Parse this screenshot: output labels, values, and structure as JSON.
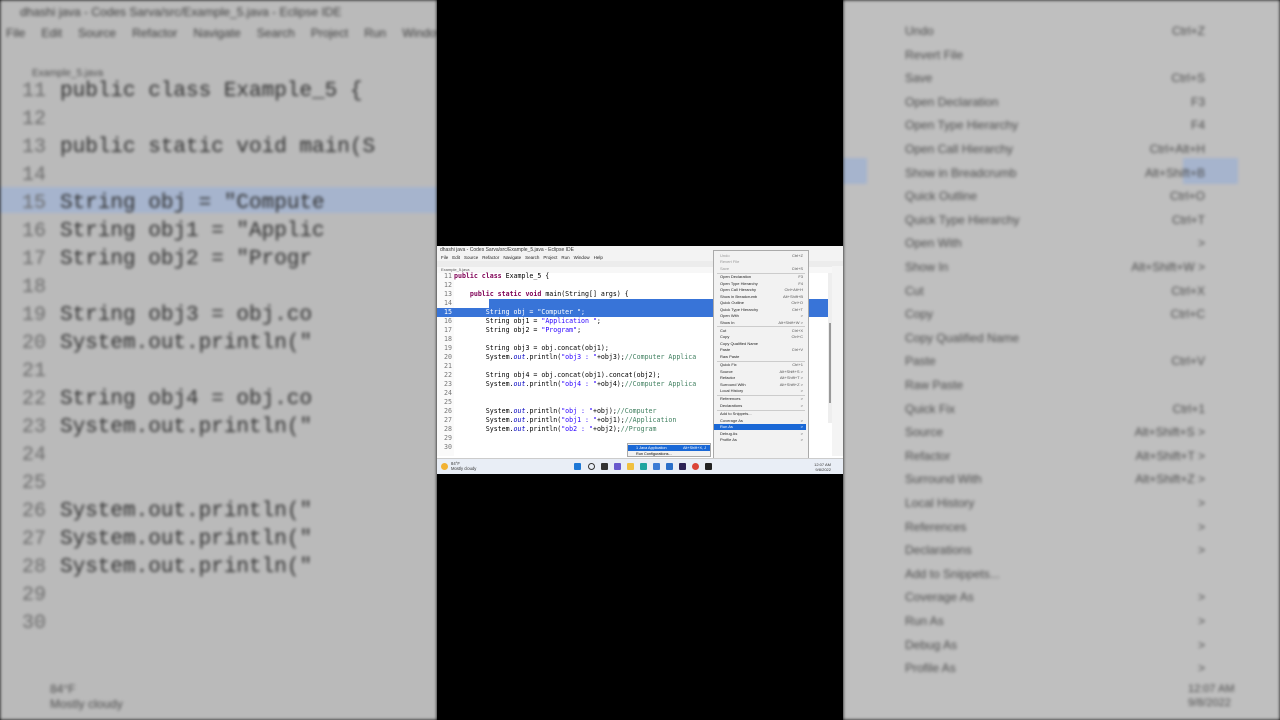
{
  "window": {
    "title": "dhashi java - Codes Sarva/src/Example_5.java - Eclipse IDE",
    "menu": [
      "File",
      "Edit",
      "Source",
      "Refactor",
      "Navigate",
      "Search",
      "Project",
      "Run",
      "Window",
      "Help"
    ],
    "tab": "Example_5.java"
  },
  "editor": {
    "lines": [
      {
        "n": "11",
        "tokens": [
          {
            "t": "public class ",
            "c": "kw"
          },
          {
            "t": "Example_5 {",
            "c": ""
          }
        ]
      },
      {
        "n": "12",
        "tokens": []
      },
      {
        "n": "13",
        "tokens": [
          {
            "t": "    ",
            "c": ""
          },
          {
            "t": "public static void",
            "c": "kw"
          },
          {
            "t": " main(String[] args) {",
            "c": ""
          }
        ]
      },
      {
        "n": "14",
        "tokens": [
          {
            "t": "        ",
            "c": ""
          }
        ],
        "highlight": "partial"
      },
      {
        "n": "15",
        "tokens": [
          {
            "t": "        String obj = ",
            "c": ""
          },
          {
            "t": "\"Computer \"",
            "c": "str"
          },
          {
            "t": ";",
            "c": ""
          }
        ],
        "highlight": "full"
      },
      {
        "n": "16",
        "tokens": [
          {
            "t": "        String obj1 = ",
            "c": ""
          },
          {
            "t": "\"Application \"",
            "c": "str"
          },
          {
            "t": ";",
            "c": ""
          }
        ]
      },
      {
        "n": "17",
        "tokens": [
          {
            "t": "        String obj2 = ",
            "c": ""
          },
          {
            "t": "\"Program\"",
            "c": "str"
          },
          {
            "t": ";",
            "c": ""
          }
        ]
      },
      {
        "n": "18",
        "tokens": []
      },
      {
        "n": "19",
        "tokens": [
          {
            "t": "        String obj3 = obj.concat(obj1);",
            "c": ""
          }
        ]
      },
      {
        "n": "20",
        "tokens": [
          {
            "t": "        System.",
            "c": ""
          },
          {
            "t": "out",
            "c": "fld"
          },
          {
            "t": ".println(",
            "c": ""
          },
          {
            "t": "\"obj3 : \"",
            "c": "str"
          },
          {
            "t": "+obj3);",
            "c": ""
          },
          {
            "t": "//Computer Applica",
            "c": "cmt"
          }
        ]
      },
      {
        "n": "21",
        "tokens": []
      },
      {
        "n": "22",
        "tokens": [
          {
            "t": "        String obj4 = obj.concat(obj1).concat(obj2);",
            "c": ""
          }
        ]
      },
      {
        "n": "23",
        "tokens": [
          {
            "t": "        System.",
            "c": ""
          },
          {
            "t": "out",
            "c": "fld"
          },
          {
            "t": ".println(",
            "c": ""
          },
          {
            "t": "\"obj4 : \"",
            "c": "str"
          },
          {
            "t": "+obj4);",
            "c": ""
          },
          {
            "t": "//Computer Applica",
            "c": "cmt"
          }
        ]
      },
      {
        "n": "24",
        "tokens": []
      },
      {
        "n": "25",
        "tokens": []
      },
      {
        "n": "26",
        "tokens": [
          {
            "t": "        System.",
            "c": ""
          },
          {
            "t": "out",
            "c": "fld"
          },
          {
            "t": ".println(",
            "c": ""
          },
          {
            "t": "\"obj : \"",
            "c": "str"
          },
          {
            "t": "+obj);",
            "c": ""
          },
          {
            "t": "//Computer",
            "c": "cmt"
          }
        ]
      },
      {
        "n": "27",
        "tokens": [
          {
            "t": "        System.",
            "c": ""
          },
          {
            "t": "out",
            "c": "fld"
          },
          {
            "t": ".println(",
            "c": ""
          },
          {
            "t": "\"obj1 : \"",
            "c": "str"
          },
          {
            "t": "+obj1);",
            "c": ""
          },
          {
            "t": "//Application",
            "c": "cmt"
          }
        ]
      },
      {
        "n": "28",
        "tokens": [
          {
            "t": "        System.",
            "c": ""
          },
          {
            "t": "out",
            "c": "fld"
          },
          {
            "t": ".println(",
            "c": ""
          },
          {
            "t": "\"ob2 : \"",
            "c": "str"
          },
          {
            "t": "+obj2);",
            "c": ""
          },
          {
            "t": "//Program",
            "c": "cmt"
          }
        ]
      },
      {
        "n": "29",
        "tokens": []
      },
      {
        "n": "30",
        "tokens": []
      }
    ]
  },
  "context_menu": {
    "items": [
      {
        "label": "Undo",
        "shortcut": "Ctrl+Z",
        "dim": true
      },
      {
        "label": "Revert File",
        "shortcut": "",
        "dim": true
      },
      {
        "label": "Save",
        "shortcut": "Ctrl+S",
        "dim": true
      },
      {
        "sep": true
      },
      {
        "label": "Open Declaration",
        "shortcut": "F3"
      },
      {
        "label": "Open Type Hierarchy",
        "shortcut": "F4"
      },
      {
        "label": "Open Call Hierarchy",
        "shortcut": "Ctrl+Alt+H"
      },
      {
        "label": "Show in Breadcrumb",
        "shortcut": "Alt+Shift+B"
      },
      {
        "label": "Quick Outline",
        "shortcut": "Ctrl+O"
      },
      {
        "label": "Quick Type Hierarchy",
        "shortcut": "Ctrl+T"
      },
      {
        "label": "Open With",
        "shortcut": ">"
      },
      {
        "label": "Show In",
        "shortcut": "Alt+Shift+W >"
      },
      {
        "sep": true
      },
      {
        "label": "Cut",
        "shortcut": "Ctrl+X"
      },
      {
        "label": "Copy",
        "shortcut": "Ctrl+C"
      },
      {
        "label": "Copy Qualified Name",
        "shortcut": ""
      },
      {
        "label": "Paste",
        "shortcut": "Ctrl+V"
      },
      {
        "label": "Raw Paste",
        "shortcut": ""
      },
      {
        "sep": true
      },
      {
        "label": "Quick Fix",
        "shortcut": "Ctrl+1"
      },
      {
        "label": "Source",
        "shortcut": "Alt+Shift+S >"
      },
      {
        "label": "Refactor",
        "shortcut": "Alt+Shift+T >"
      },
      {
        "label": "Surround With",
        "shortcut": "Alt+Shift+Z >"
      },
      {
        "label": "Local History",
        "shortcut": ">"
      },
      {
        "sep": true
      },
      {
        "label": "References",
        "shortcut": ">"
      },
      {
        "label": "Declarations",
        "shortcut": ">"
      },
      {
        "sep": true
      },
      {
        "label": "Add to Snippets...",
        "shortcut": ""
      },
      {
        "label": "Coverage As",
        "shortcut": ">"
      },
      {
        "label": "Run As",
        "shortcut": ">",
        "selected": true
      },
      {
        "label": "Debug As",
        "shortcut": ">"
      },
      {
        "label": "Profile As",
        "shortcut": ">"
      }
    ]
  },
  "submenu": {
    "items": [
      {
        "label": "1 Java Application",
        "shortcut": "Alt+Shift+X, J",
        "selected": true
      },
      {
        "label": "Run Configurations...",
        "shortcut": ""
      }
    ]
  },
  "taskbar": {
    "weather_temp": "84°F",
    "weather_desc": "Mostly cloudy",
    "time": "12:07 AM",
    "date": "9/8/2022"
  },
  "background_left": {
    "title": "dhashi java - Codes Sarva/src/Example_5.java - Eclipse IDE",
    "menu": [
      "File",
      "Edit",
      "Source",
      "Refactor",
      "Navigate",
      "Search",
      "Project",
      "Run",
      "Window"
    ],
    "tab": "Example_5.java",
    "lines": [
      {
        "n": "11",
        "text": "public class Example_5 {"
      },
      {
        "n": "12",
        "text": ""
      },
      {
        "n": "13",
        "text": "    public static void main(S"
      },
      {
        "n": "14",
        "text": ""
      },
      {
        "n": "15",
        "text": "        String obj = \"Compute"
      },
      {
        "n": "16",
        "text": "        String obj1 = \"Applic"
      },
      {
        "n": "17",
        "text": "        String obj2 = \"Progr"
      },
      {
        "n": "18",
        "text": ""
      },
      {
        "n": "19",
        "text": "        String obj3 = obj.co"
      },
      {
        "n": "20",
        "text": "        System.out.println(\""
      },
      {
        "n": "21",
        "text": ""
      },
      {
        "n": "22",
        "text": "        String obj4 = obj.co"
      },
      {
        "n": "23",
        "text": "        System.out.println(\""
      },
      {
        "n": "24",
        "text": ""
      },
      {
        "n": "25",
        "text": ""
      },
      {
        "n": "26",
        "text": "        System.out.println(\""
      },
      {
        "n": "27",
        "text": "        System.out.println(\""
      },
      {
        "n": "28",
        "text": "        System.out.println(\""
      },
      {
        "n": "29",
        "text": ""
      },
      {
        "n": "30",
        "text": ""
      }
    ],
    "weather_temp": "84°F",
    "weather_desc": "Mostly cloudy"
  },
  "background_right": {
    "items": [
      {
        "label": "Undo",
        "shortcut": "Ctrl+Z"
      },
      {
        "label": "Revert File",
        "shortcut": ""
      },
      {
        "label": "Save",
        "shortcut": "Ctrl+S"
      },
      {
        "label": "Open Declaration",
        "shortcut": "F3"
      },
      {
        "label": "Open Type Hierarchy",
        "shortcut": "F4"
      },
      {
        "label": "Open Call Hierarchy",
        "shortcut": "Ctrl+Alt+H"
      },
      {
        "label": "Show in Breadcrumb",
        "shortcut": "Alt+Shift+B"
      },
      {
        "label": "Quick Outline",
        "shortcut": "Ctrl+O"
      },
      {
        "label": "Quick Type Hierarchy",
        "shortcut": "Ctrl+T"
      },
      {
        "label": "Open With",
        "shortcut": ">"
      },
      {
        "label": "Show In",
        "shortcut": "Alt+Shift+W >"
      },
      {
        "label": "Cut",
        "shortcut": "Ctrl+X"
      },
      {
        "label": "Copy",
        "shortcut": "Ctrl+C"
      },
      {
        "label": "Copy Qualified Name",
        "shortcut": ""
      },
      {
        "label": "Paste",
        "shortcut": "Ctrl+V"
      },
      {
        "label": "Raw Paste",
        "shortcut": ""
      },
      {
        "label": "Quick Fix",
        "shortcut": "Ctrl+1"
      },
      {
        "label": "Source",
        "shortcut": "Alt+Shift+S >"
      },
      {
        "label": "Refactor",
        "shortcut": "Alt+Shift+T >"
      },
      {
        "label": "Surround With",
        "shortcut": "Alt+Shift+Z >"
      },
      {
        "label": "Local History",
        "shortcut": ">"
      },
      {
        "label": "References",
        "shortcut": ">"
      },
      {
        "label": "Declarations",
        "shortcut": ">"
      },
      {
        "label": "Add to Snippets...",
        "shortcut": ""
      },
      {
        "label": "Coverage As",
        "shortcut": ">"
      },
      {
        "label": "Run As",
        "shortcut": ">"
      },
      {
        "label": "Debug As",
        "shortcut": ">"
      },
      {
        "label": "Profile As",
        "shortcut": ">"
      }
    ],
    "time": "12:07 AM",
    "date": "9/8/2022"
  },
  "colors": {
    "selection": "#3874d8",
    "menu_selection": "#1a68d6",
    "keyword": "#7f0055",
    "string": "#2a00ff",
    "comment": "#3f7f5f"
  }
}
